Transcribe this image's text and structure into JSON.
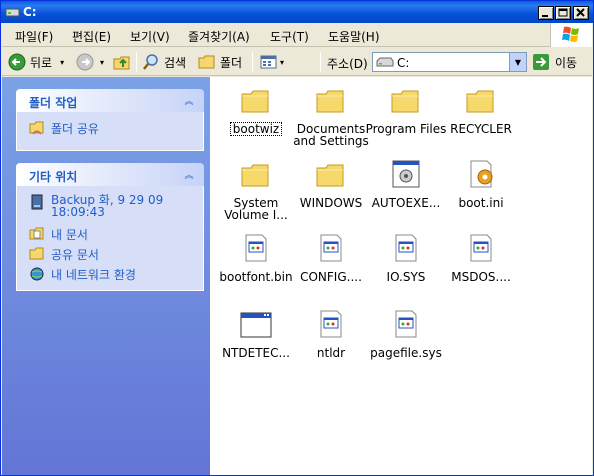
{
  "window": {
    "title": "C:"
  },
  "menubar": {
    "items": [
      "파일(F)",
      "편집(E)",
      "보기(V)",
      "즐겨찾기(A)",
      "도구(T)",
      "도움말(H)"
    ]
  },
  "toolbar": {
    "back": "뒤로",
    "search": "검색",
    "folders": "폴더",
    "address_label": "주소(D)",
    "address_value": "C:",
    "go": "이동"
  },
  "taskpane": {
    "folder_tasks": {
      "title": "폴더 작업",
      "items": [
        "폴더 공유"
      ]
    },
    "other_places": {
      "title": "기타 위치",
      "items": [
        "Backup 화, 9 29 09 18:09:43",
        "내 문서",
        "공유 문서",
        "내 네트워크 환경"
      ]
    }
  },
  "files": [
    {
      "name": "bootwiz",
      "type": "folder"
    },
    {
      "name": "Documents and Settings",
      "type": "folder"
    },
    {
      "name": "Program Files",
      "type": "folder"
    },
    {
      "name": "RECYCLER",
      "type": "folder"
    },
    {
      "name": "System Volume I...",
      "type": "folder"
    },
    {
      "name": "WINDOWS",
      "type": "folder"
    },
    {
      "name": "AUTOEXE...",
      "type": "batch"
    },
    {
      "name": "boot.ini",
      "type": "ini"
    },
    {
      "name": "bootfont.bin",
      "type": "sysfile"
    },
    {
      "name": "CONFIG....",
      "type": "sysfile"
    },
    {
      "name": "IO.SYS",
      "type": "sysfile"
    },
    {
      "name": "MSDOS....",
      "type": "sysfile"
    },
    {
      "name": "NTDETEC...",
      "type": "app"
    },
    {
      "name": "ntldr",
      "type": "sysfile"
    },
    {
      "name": "pagefile.sys",
      "type": "sysfile"
    }
  ]
}
